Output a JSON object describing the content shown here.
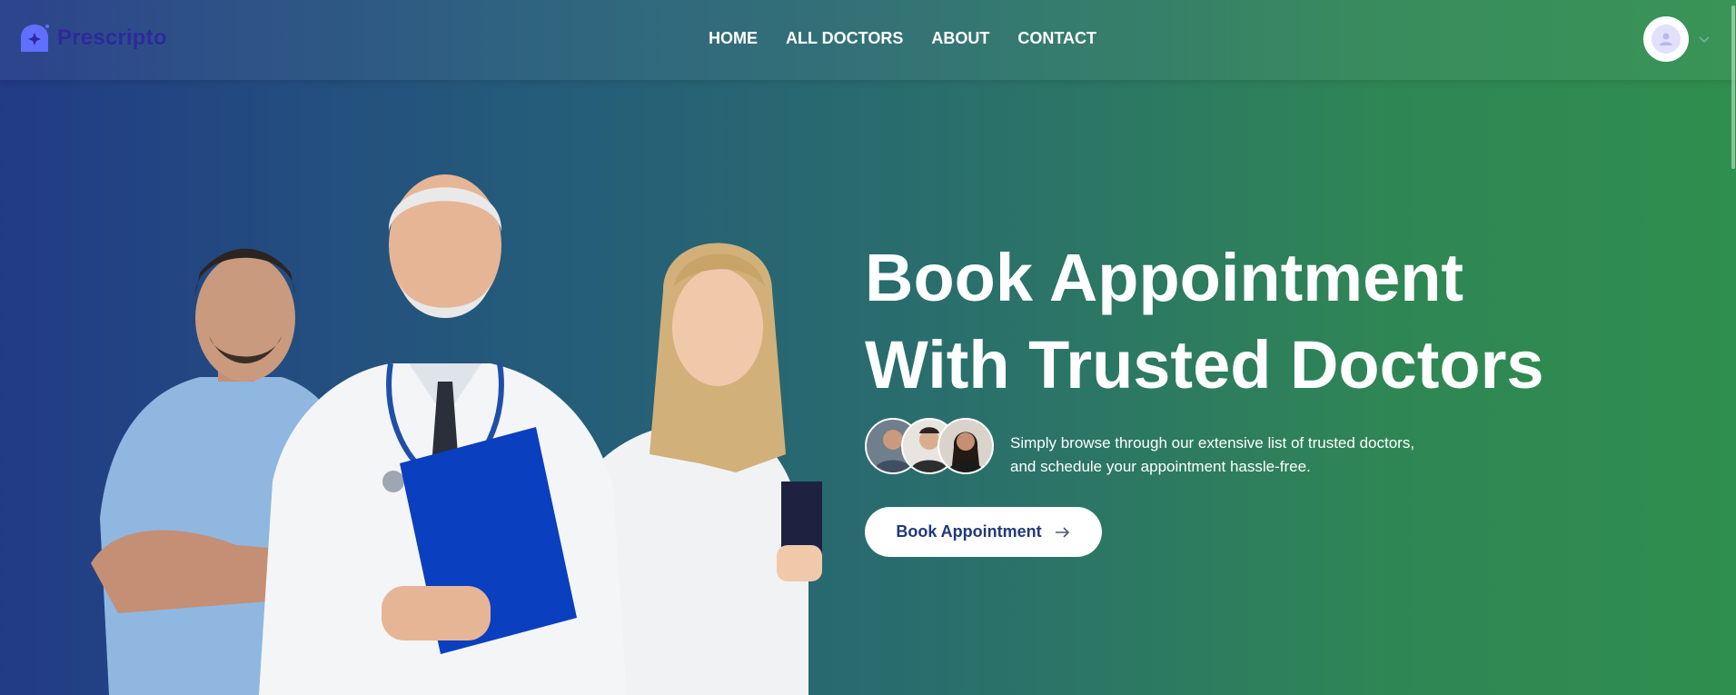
{
  "brand": {
    "name": "Prescripto"
  },
  "nav": {
    "links": [
      {
        "label": "HOME"
      },
      {
        "label": "ALL DOCTORS"
      },
      {
        "label": "ABOUT"
      },
      {
        "label": "CONTACT"
      }
    ]
  },
  "profile": {
    "avatar_icon": "user-icon",
    "menu_icon": "chevron-down-icon"
  },
  "hero": {
    "title_line1": "Book Appointment",
    "title_line2": "With Trusted Doctors",
    "subtitle_line1": "Simply browse through our extensive list of trusted doctors,",
    "subtitle_line2": "and schedule your appointment hassle-free.",
    "cta_label": "Book Appointment",
    "cta_icon": "arrow-right-icon"
  },
  "colors": {
    "gradient_start": "#223b86",
    "gradient_end": "#2f8f4e",
    "brand": "#2d2a9b",
    "logo_mark": "#5f6fff",
    "button_text": "#1f3a7a"
  }
}
